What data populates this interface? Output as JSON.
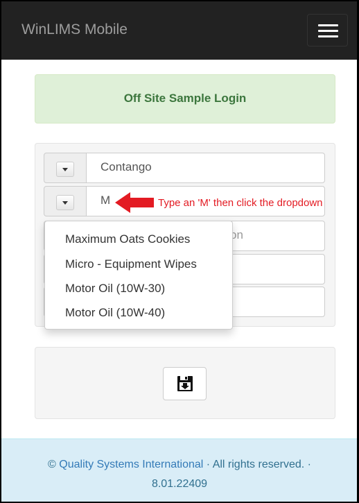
{
  "navbar": {
    "brand": "WinLIMS Mobile",
    "menu_icon": "hamburger-icon"
  },
  "alert": {
    "title": "Off Site Sample Login"
  },
  "form": {
    "client_field": {
      "value": "Contango",
      "dropdown_icon": "caret-down-icon"
    },
    "product_field": {
      "value": "M",
      "dropdown_icon": "caret-down-icon"
    },
    "hidden_field_placeholder_fragment": "on"
  },
  "annotation": {
    "text": "Type an 'M' then click the dropdown",
    "arrow_icon": "red-left-arrow-icon",
    "color": "#e31b23"
  },
  "dropdown": {
    "options": [
      "Maximum Oats Cookies",
      "Micro - Equipment Wipes",
      "Motor Oil (10W-30)",
      "Motor Oil (10W-40)"
    ]
  },
  "save": {
    "icon": "save-floppy-icon"
  },
  "footer": {
    "copyright": "©",
    "company": "Quality Systems International",
    "rights": " · All rights reserved. ·",
    "version": "8.01.22409"
  },
  "colors": {
    "navbar_bg": "#222222",
    "alert_bg": "#dff0d8",
    "alert_text": "#3c763d",
    "footer_bg": "#d9edf7",
    "link": "#337ab7"
  }
}
